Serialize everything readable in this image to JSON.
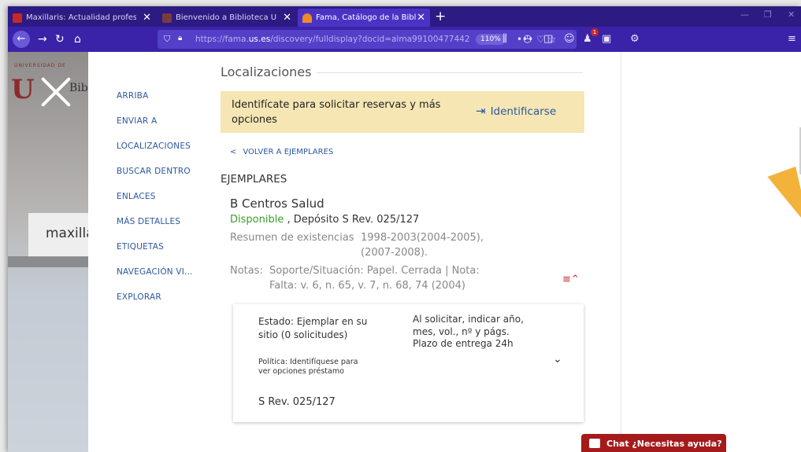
{
  "browser": {
    "tabs": [
      {
        "label": "Maxillaris: Actualidad profesion",
        "icon_color": "#c62828"
      },
      {
        "label": "Bienvenido a Biblioteca Univer",
        "icon_color": "#7a3b3b"
      },
      {
        "label": "Fama, Catálogo de la Bibliotec",
        "icon_color": "#f08a24"
      }
    ],
    "new_tab": "+",
    "url_prefix": "https://fama.",
    "url_domain": "us.es",
    "url_path": "/discovery/fulldisplay?docid=alma99100477442",
    "zoom": "110%",
    "url_icons": "••• ♡ ☆",
    "notifications_badge": "1",
    "accent": "#3a23a8"
  },
  "left_panel": {
    "logo_univ": "UNIVERSIDAD DE",
    "logo_u": "U",
    "logo_bib": "Bib",
    "search_text": "maxilla"
  },
  "nav": {
    "items": [
      "ARRIBA",
      "ENVIAR A",
      "LOCALIZACIONES",
      "BUSCAR DENTRO",
      "ENLACES",
      "MÁS DETALLES",
      "ETIQUETAS",
      "NAVEGACIÓN VI...",
      "EXPLORAR"
    ]
  },
  "main": {
    "section_title": "Localizaciones",
    "login_text": "Identifícate para solicitar reservas y más opciones",
    "login_button": "Identificarse",
    "back_link": "VOLVER A EJEMPLARES",
    "ejemplares_title": "EJEMPLARES",
    "library": "B Centros Salud",
    "status": "Disponible",
    "location": " , Depósito S Rev. 025/127",
    "holdings_label": "Resumen de existencias",
    "holdings_value_1": "1998-2003(2004-2005),",
    "holdings_value_2": "(2007-2008).",
    "notes_label": "Notas:",
    "notes_value_1": "Soporte/Situación: Papel. Cerrada | Nota:",
    "notes_value_2": "Falta: v. 6, n. 65, v. 7, n. 68, 74 (2004)",
    "sort_icon": "≡⌃",
    "item": {
      "estado": "Estado: Ejemplar en su sitio (0 solicitudes)",
      "politica": "Política: Identifíquese para ver opciones préstamo",
      "signatura": "S Rev. 025/127",
      "nota": "Al solicitar, indicar año, mes, vol., nº y págs. Plazo de entrega 24h"
    }
  },
  "chat": {
    "label": "Chat ¿Necesitas ayuda?",
    "color": "#a51b1b"
  }
}
